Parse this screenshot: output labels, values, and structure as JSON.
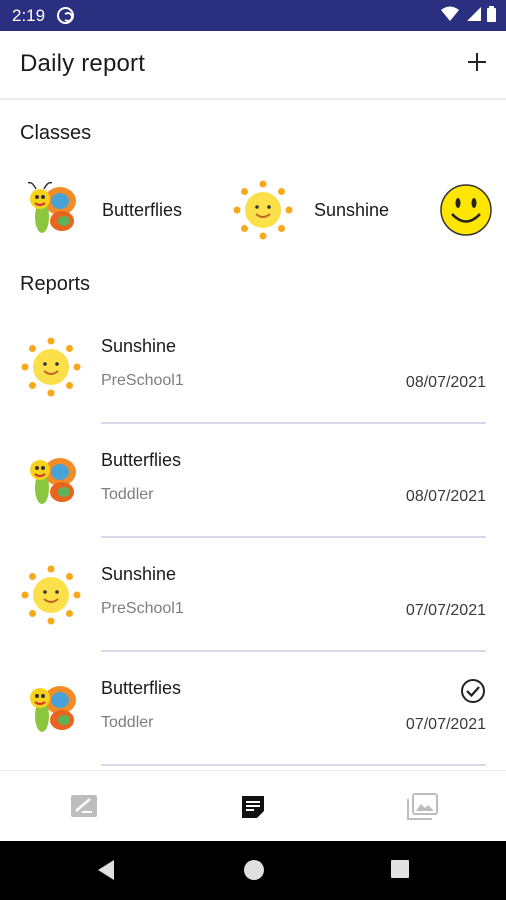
{
  "status_bar": {
    "time": "2:19"
  },
  "header": {
    "title": "Daily report",
    "add_icon": "plus-icon"
  },
  "classes_section": {
    "title": "Classes",
    "items": [
      {
        "name": "Butterflies",
        "icon": "butterfly-icon"
      },
      {
        "name": "Sunshine",
        "icon": "sun-icon"
      },
      {
        "name": "",
        "icon": "smiley-icon"
      }
    ]
  },
  "reports_section": {
    "title": "Reports",
    "items": [
      {
        "class_name": "Sunshine",
        "group": "PreSchool1",
        "date": "08/07/2021",
        "icon": "sun-icon",
        "checked": false
      },
      {
        "class_name": "Butterflies",
        "group": "Toddler",
        "date": "08/07/2021",
        "icon": "butterfly-icon",
        "checked": false
      },
      {
        "class_name": "Sunshine",
        "group": "PreSchool1",
        "date": "07/07/2021",
        "icon": "sun-icon",
        "checked": false
      },
      {
        "class_name": "Butterflies",
        "group": "Toddler",
        "date": "07/07/2021",
        "icon": "butterfly-icon",
        "checked": true
      }
    ]
  },
  "bottom_nav": {
    "items": [
      {
        "icon": "edit-note-icon",
        "active": false
      },
      {
        "icon": "report-icon",
        "active": true
      },
      {
        "icon": "photo-gallery-icon",
        "active": false
      }
    ]
  },
  "colors": {
    "status_bar": "#2a2f80",
    "divider": "#d9d9ec",
    "active_nav": "#111111",
    "inactive_nav": "#bdbdbd"
  }
}
